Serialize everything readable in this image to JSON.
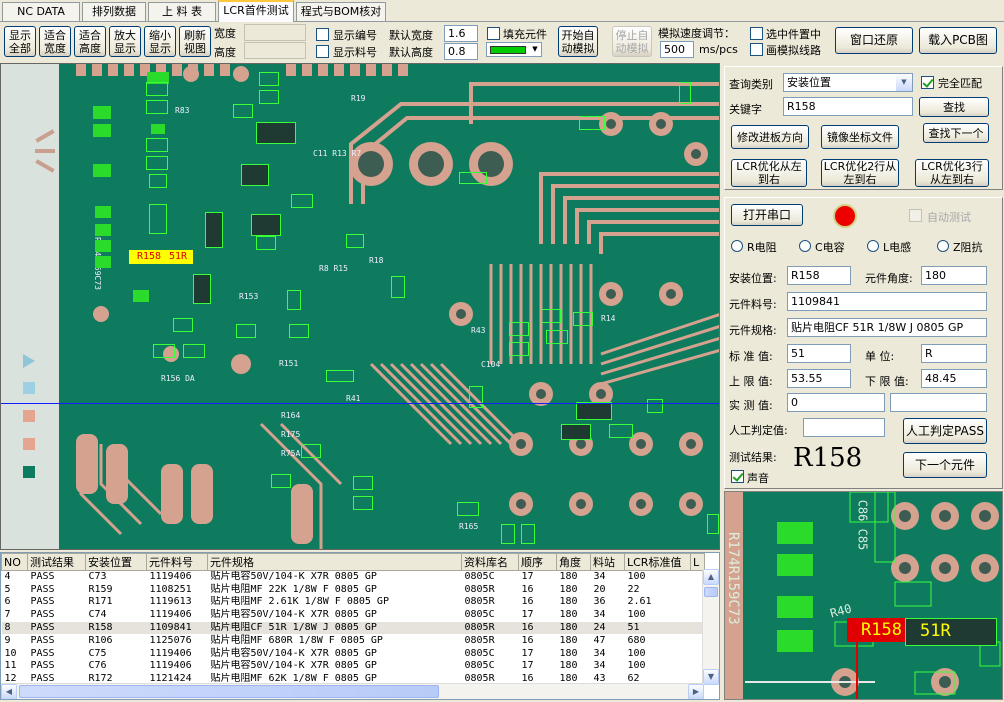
{
  "tabs": [
    {
      "label": "NC DATA"
    },
    {
      "label": "排列数据"
    },
    {
      "label": "上 料 表"
    },
    {
      "label": "LCR首件测试"
    },
    {
      "label": "程式与BOM核对"
    }
  ],
  "toolbar": {
    "show_all": "显示全部",
    "fit_width": "适合宽度",
    "fit_height": "适合高度",
    "zoom_in": "放大显示",
    "zoom_out": "缩小显示",
    "refresh": "刷新视图",
    "width_label": "宽度",
    "height_label": "高度",
    "width_value": "",
    "height_value": "",
    "show_number": "显示编号",
    "show_part": "显示料号",
    "default_width_label": "默认宽度",
    "default_height_label": "默认高度",
    "default_width": "1.6",
    "default_height": "0.8",
    "fill_component": "填充元件",
    "fill_color": "#00cc00",
    "start_sim": "开始自动模拟",
    "stop_sim": "停止自动模拟",
    "speed_label": "模拟速度调节：",
    "speed_value": "500",
    "speed_unit": "ms/pcs",
    "select_center": "选中件置中",
    "draw_route": "画模拟线路",
    "restore_window": "窗口还原",
    "load_pcb": "载入PCB图"
  },
  "query": {
    "type_label": "查询类别",
    "type_value": "安装位置",
    "exact_match": "完全匹配",
    "keyword_label": "关键字",
    "keyword_value": "R158",
    "find": "查找",
    "modify_direction": "修改进板方向",
    "mirror_file": "镜像坐标文件",
    "find_next": "查找下一个",
    "opt1": "LCR优化从左到右",
    "opt2": "LCR优化2行从左到右",
    "opt3": "LCR优化3行从左到右"
  },
  "test": {
    "open_port": "打开串口",
    "status_color": "#ee0000",
    "auto_test": "自动测试",
    "radio_r": "R电阻",
    "radio_c": "C电容",
    "radio_l": "L电感",
    "radio_z": "Z阻抗",
    "pos_label": "安装位置:",
    "pos_value": "R158",
    "angle_label": "元件角度:",
    "angle_value": "180",
    "part_label": "元件料号:",
    "part_value": "1109841",
    "spec_label": "元件规格:",
    "spec_value": "贴片电阻CF 51R 1/8W J 0805 GP",
    "std_label": "标 准 值:",
    "std_value": "51",
    "unit_label": "单    位:",
    "unit_value": "R",
    "upper_label": "上 限 值:",
    "upper_value": "53.55",
    "lower_label": "下 限 值:",
    "lower_value": "48.45",
    "measured_label": "实 测 值:",
    "measured_value": "0",
    "manual_label": "人工判定值:",
    "manual_pass": "人工判定PASS",
    "result_label": "测试结果:",
    "result_value": "R158",
    "next": "下一个元件",
    "sound": "声音"
  },
  "pcb": {
    "highlight_label": "R158",
    "highlight_value": "51R",
    "zoom_label": "R158",
    "zoom_value": "51R"
  },
  "grid": {
    "columns": [
      "NO",
      "测试结果",
      "安装位置",
      "元件料号",
      "元件规格",
      "资料库名",
      "顺序",
      "角度",
      "料站",
      "LCR标准值",
      "L"
    ],
    "rows": [
      [
        "4",
        "PASS",
        "C73",
        "1119406",
        "贴片电容50V/104-K X7R 0805 GP",
        "0805C",
        "17",
        "180",
        "34",
        "100"
      ],
      [
        "5",
        "PASS",
        "R159",
        "1108251",
        "贴片电阻MF 22K 1/8W F 0805 GP",
        "0805R",
        "16",
        "180",
        "20",
        "22"
      ],
      [
        "6",
        "PASS",
        "R171",
        "1119613",
        "贴片电阻MF 2.61K 1/8W F 0805 GP",
        "0805R",
        "16",
        "180",
        "36",
        "2.61"
      ],
      [
        "7",
        "PASS",
        "C74",
        "1119406",
        "贴片电容50V/104-K X7R 0805 GP",
        "0805C",
        "17",
        "180",
        "34",
        "100"
      ],
      [
        "8",
        "PASS",
        "R158",
        "1109841",
        "贴片电阻CF 51R 1/8W J 0805 GP",
        "0805R",
        "16",
        "180",
        "24",
        "51"
      ],
      [
        "9",
        "PASS",
        "R106",
        "1125076",
        "贴片电阻MF 680R 1/8W F 0805 GP",
        "0805R",
        "16",
        "180",
        "47",
        "680"
      ],
      [
        "10",
        "PASS",
        "C75",
        "1119406",
        "贴片电容50V/104-K X7R 0805 GP",
        "0805C",
        "17",
        "180",
        "34",
        "100"
      ],
      [
        "11",
        "PASS",
        "C76",
        "1119406",
        "贴片电容50V/104-K X7R 0805 GP",
        "0805C",
        "17",
        "180",
        "34",
        "100"
      ],
      [
        "12",
        "PASS",
        "R172",
        "1121424",
        "贴片电阻MF 62K 1/8W F 0805 GP",
        "0805R",
        "16",
        "180",
        "43",
        "62"
      ]
    ]
  }
}
